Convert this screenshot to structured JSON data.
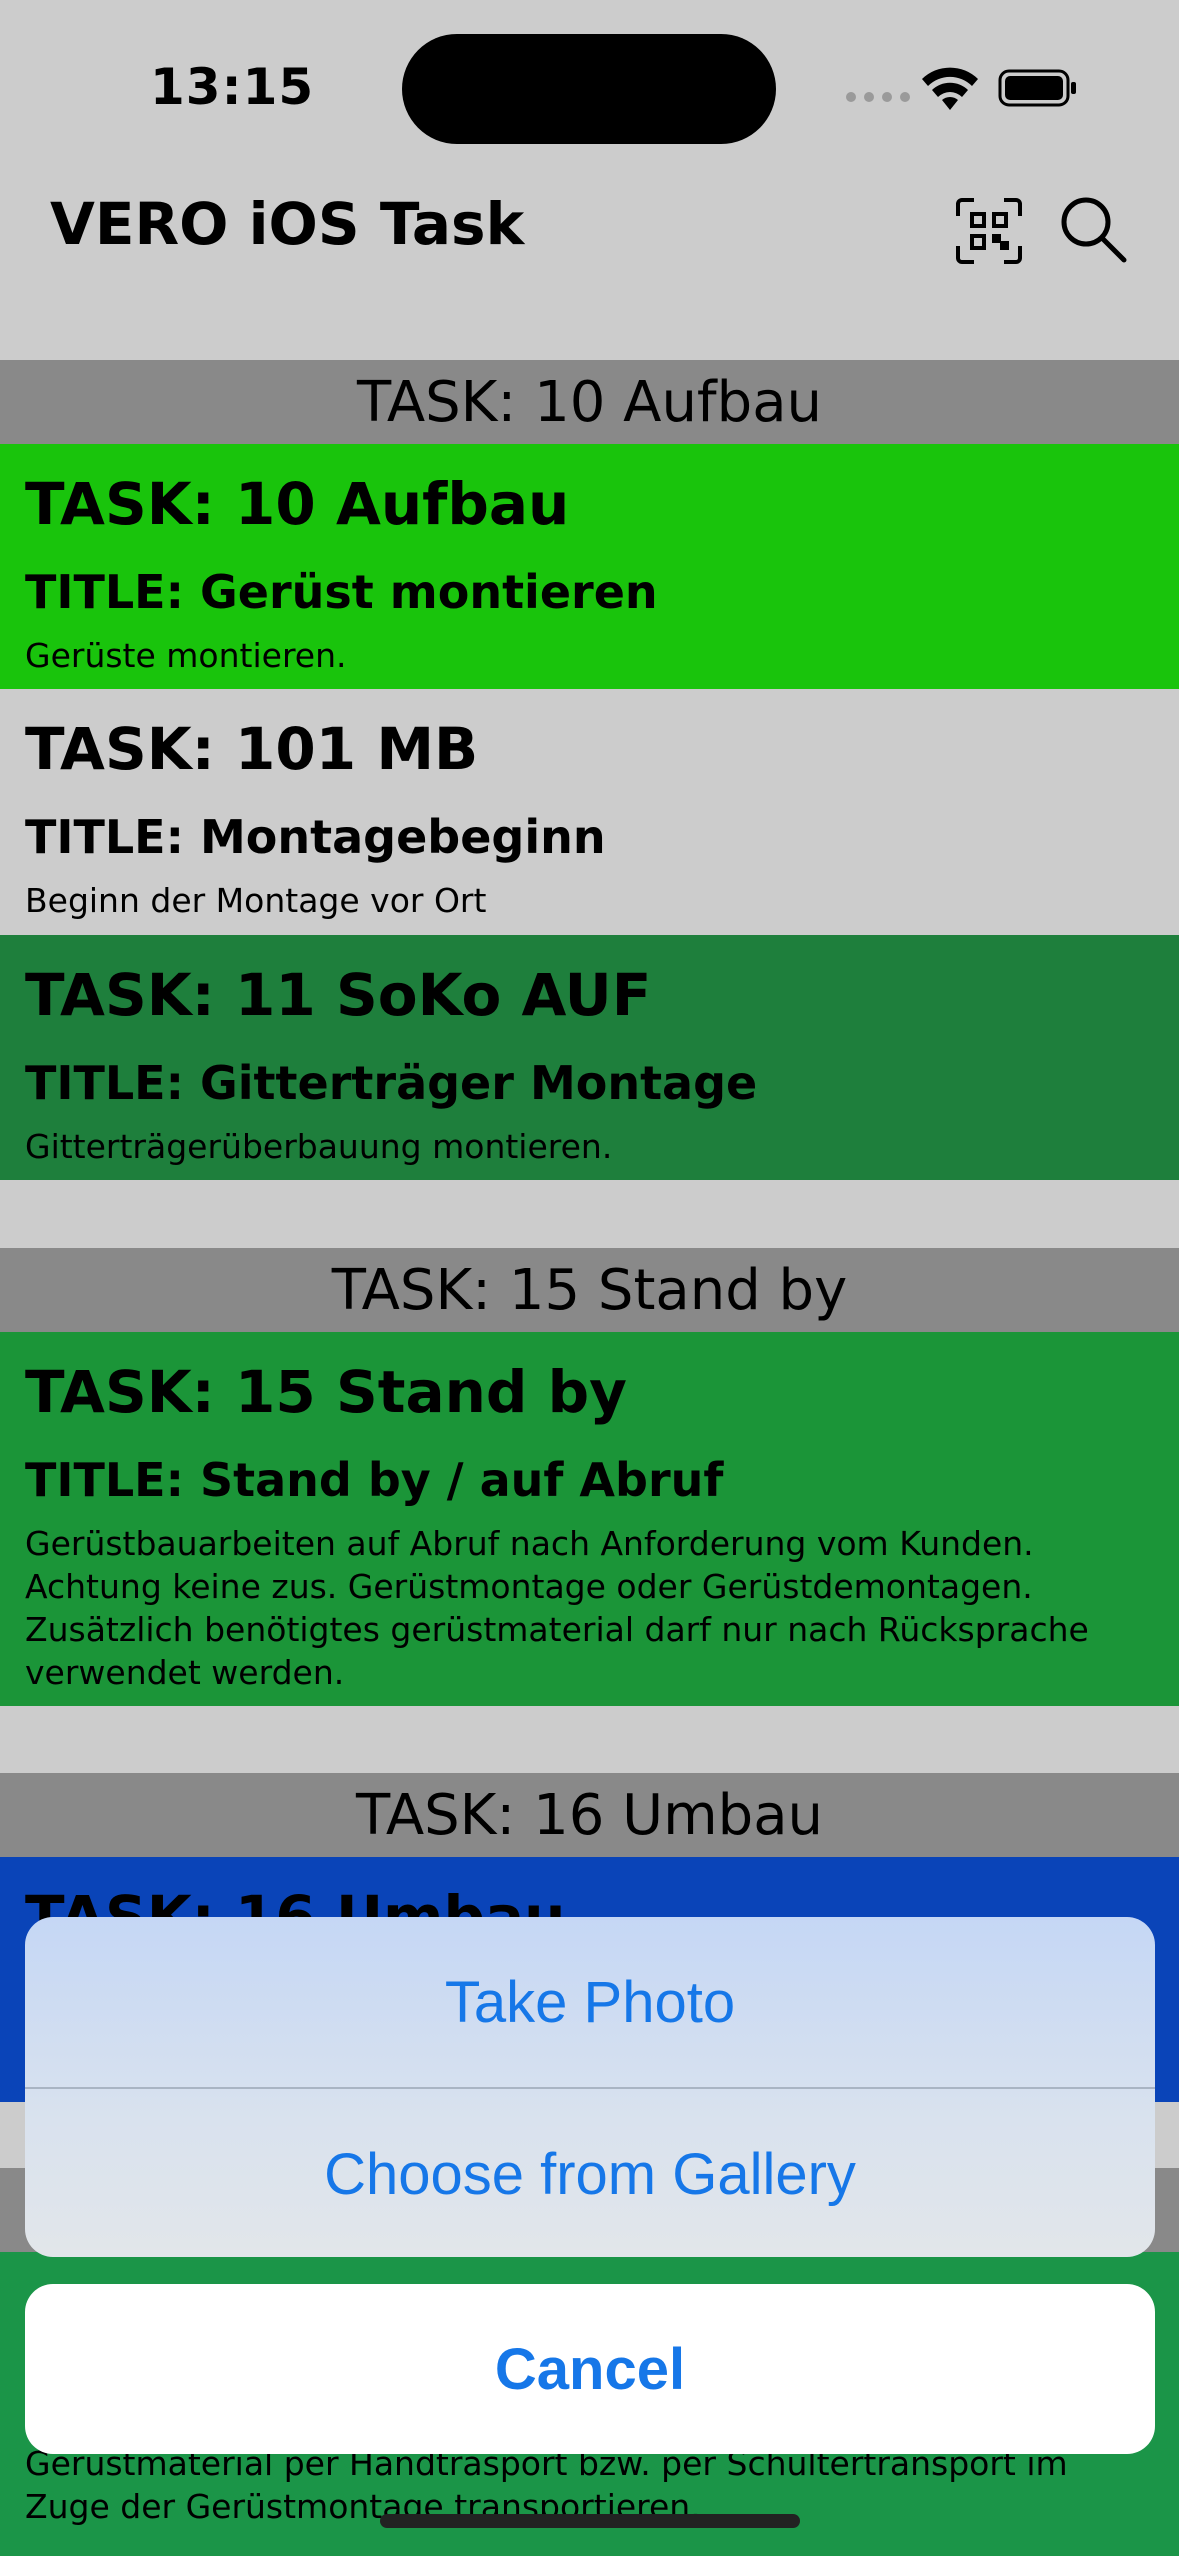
{
  "status_bar": {
    "time": "13:15"
  },
  "nav": {
    "title": "VERO iOS Task",
    "qr_icon": "qr-scan-icon",
    "search_icon": "search-icon"
  },
  "sections": [
    {
      "header": "TASK: 10 Aufbau",
      "tasks": [
        {
          "name": "TASK: 10 Aufbau",
          "title": "TITLE: Gerüst montieren",
          "desc": "Gerüste montieren.",
          "color": "#19c40c"
        },
        {
          "name": "TASK: 101 MB",
          "title": "TITLE: Montagebeginn",
          "desc": "Beginn der Montage vor Ort",
          "color": "#cccccc"
        },
        {
          "name": "TASK: 11 SoKo AUF",
          "title": "TITLE: Gitterträger Montage",
          "desc": "Gitterträgerüberbauung montieren.",
          "color": "#1e7f3c"
        }
      ]
    },
    {
      "header": "TASK: 15 Stand by",
      "tasks": [
        {
          "name": "TASK: 15 Stand by",
          "title": "TITLE: Stand by / auf Abruf",
          "desc": "Gerüstbauarbeiten auf Abruf nach Anforderung vom Kunden. Achtung keine zus. Gerüstmontage oder Gerüstdemontagen. Zusätzlich benötigtes gerüstmaterial darf nur nach Rücksprache verwendet werden.",
          "color": "#1b9538"
        }
      ]
    },
    {
      "header": "TASK: 16 Umbau",
      "tasks": [
        {
          "name": "TASK: 16 Umbau",
          "color": "#0a44b8"
        }
      ]
    }
  ],
  "partial_bottom_card": {
    "desc": "Gerüstmaterial per Handtrasport bzw. per Schultertransport im Zuge der Gerüstmontage transportieren.",
    "color": "#1b9548"
  },
  "action_sheet": {
    "take_photo": "Take Photo",
    "choose_gallery": "Choose from Gallery",
    "cancel": "Cancel",
    "accent": "#1677e8"
  }
}
